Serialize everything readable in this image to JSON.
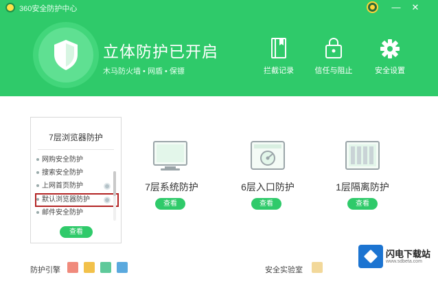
{
  "window": {
    "title": "360安全防护中心",
    "minimize_glyph": "—",
    "close_glyph": "✕"
  },
  "header": {
    "status_title": "立体防护已开启",
    "status_subtitle": "木马防火墙 • 网盾 • 保镖",
    "actions": [
      {
        "label": "拦截记录",
        "icon": "book-icon"
      },
      {
        "label": "信任与阻止",
        "icon": "lock-bag-icon"
      },
      {
        "label": "安全设置",
        "icon": "gear-icon"
      }
    ]
  },
  "browser_card": {
    "title": "7层浏览器防护",
    "features": [
      {
        "label": "网购安全防护"
      },
      {
        "label": "搜索安全防护"
      },
      {
        "label": "上网首页防护"
      },
      {
        "label": "默认浏览器防护"
      },
      {
        "label": "邮件安全防护"
      }
    ],
    "button": "查看"
  },
  "modules": [
    {
      "title": "7层系统防护",
      "button": "查看",
      "icon": "monitor-icon"
    },
    {
      "title": "6层入口防护",
      "button": "查看",
      "icon": "disk-icon"
    },
    {
      "title": "1层隔离防护",
      "button": "查看",
      "icon": "server-icon"
    }
  ],
  "footer": {
    "engine_label": "防护引擎",
    "engines": [
      {
        "color": "#f08a7c",
        "icon": "engine-1-icon"
      },
      {
        "color": "#f2c14a",
        "icon": "engine-2-icon"
      },
      {
        "color": "#5ec99a",
        "icon": "engine-3-icon"
      },
      {
        "color": "#5aa9de",
        "icon": "engine-4-icon"
      }
    ],
    "lab_label": "安全实验室"
  },
  "watermark": {
    "text": "闪电下载站",
    "url": "www.sdbeta.com"
  },
  "colors": {
    "brand_green": "#2fca6a",
    "highlight_red": "#b22222"
  }
}
